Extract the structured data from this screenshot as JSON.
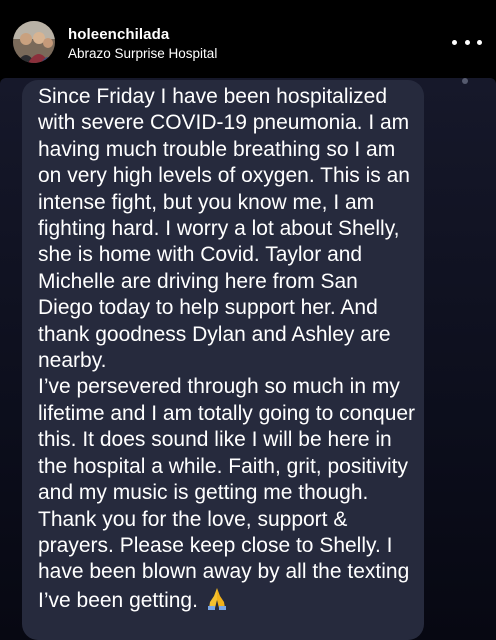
{
  "post_header": {
    "username": "holeenchilada",
    "location": "Abrazo Surprise Hospital",
    "avatar_icon": "profile-photo-avatar",
    "more_icon": "three-dots-more-icon"
  },
  "message": {
    "text": "Since Friday I have been hospitalized with severe COVID-19 pneumonia. I am having much trouble breathing so I am on very high levels of oxygen. This is an intense fight, but you know me, I am fighting hard. I worry a lot about Shelly, she is home with Covid. Taylor and Michelle are driving here from San Diego today to help support her. And thank goodness Dylan and Ashley are nearby.\nI’ve persevered through so much in my lifetime and I am totally going to conquer this. It does sound like I will be here in the hospital a while. Faith, grit, positivity and my music is getting me though. Thank you for the love, support & prayers. Please keep close to Shelly. I have been blown away by all the texting I’ve been getting.",
    "emoji_icon": "praying-hands-icon"
  },
  "colors": {
    "background": "#000000",
    "bubble": "#262a3d",
    "text": "#ffffff",
    "emoji": "#f5c12e"
  }
}
